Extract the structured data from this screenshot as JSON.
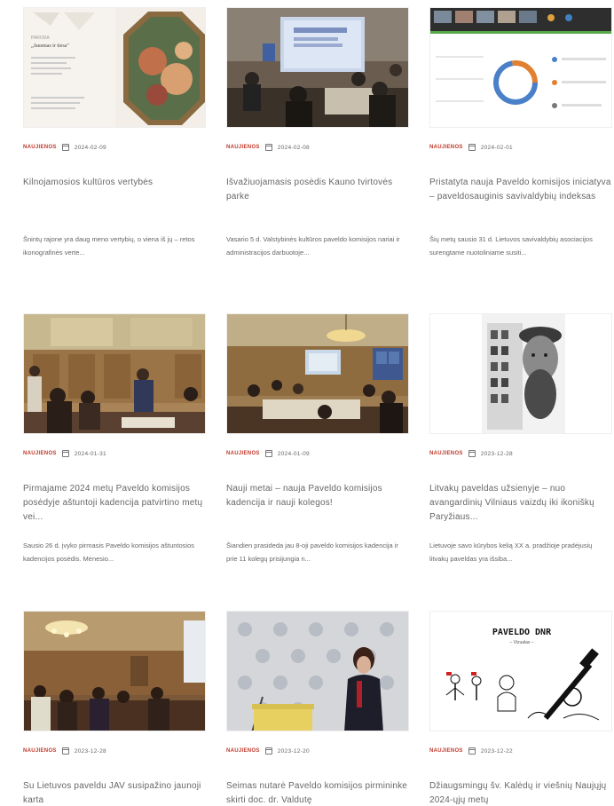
{
  "articles": [
    {
      "category": "Naujienos",
      "date": "2024-02-09",
      "title": "Kilnojamosios kultūros vertybės",
      "excerpt": "Šnintų rajone yra daug meno vertybių, o viena iš jų – retos ikonografinės verte..."
    },
    {
      "category": "Naujienos",
      "date": "2024-02-08",
      "title": "Išvažiuojamasis posėdis Kauno tvirtovės parke",
      "excerpt": "Vasario 5 d. Valstybinės kultūros paveldo komisijos nariai ir administracijos darbuotoje..."
    },
    {
      "category": "Naujienos",
      "date": "2024-02-01",
      "title": "Pristatyta nauja Paveldo komisijos iniciatyva – paveldosauginis savivaldybių indeksas",
      "excerpt": "Šių metų sausio 31 d. Lietuvos savivaldybių asociacijos surengtame nuotoliniame susiti..."
    },
    {
      "category": "Naujienos",
      "date": "2024-01-31",
      "title": "Pirmajame 2024 metų Paveldo komisijos posėdyje aštuntoji kadencija patvirtino metų vei...",
      "excerpt": "Sausio 26 d. įvyko pirmasis Paveldo komisijos aštuntosios kadencijos posėdis. Mėnesio..."
    },
    {
      "category": "Naujienos",
      "date": "2024-01-09",
      "title": "Nauji metai – nauja Paveldo komisijos kadencija ir nauji kolegos!",
      "excerpt": "Šiandien prasideda jau 8-oji paveldo komisijos kadencija ir prie 11 kolegų prisijungia n..."
    },
    {
      "category": "Naujienos",
      "date": "2023-12-28",
      "title": "Litvakų paveldas užsienyje – nuo avangardinių Vilniaus vaizdų iki ikoniškų Paryžiaus...",
      "excerpt": "Lietuvoje savo kūrybos kelią XX a. pradžioje pradėjusių litvakų paveldas yra išsiba..."
    },
    {
      "category": "Naujienos",
      "date": "2023-12-28",
      "title": "Su Lietuvos paveldu JAV susipažino jaunoji karta",
      "excerpt": ""
    },
    {
      "category": "Naujienos",
      "date": "2023-12-20",
      "title": "Seimas nutarė Paveldo komisijos pirmininke skirti doc. dr. Valdutę",
      "excerpt": ""
    },
    {
      "category": "Naujienos",
      "date": "2023-12-22",
      "title": "Džiaugsmingų šv. Kalėdų ir viešnių Naujųjų 2024-ųjų metų",
      "excerpt": ""
    }
  ],
  "thumb_text": {
    "poster_heading": "„Jausmas ir tiesa\"",
    "comic_title": "PAVELDO DNR",
    "comic_subtitle": "– Vizualas –"
  },
  "colors": {
    "accent": "#c0392b"
  }
}
